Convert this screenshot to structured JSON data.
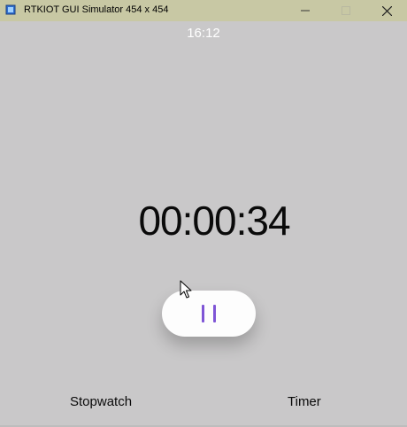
{
  "window": {
    "title": "RTKIOT GUI Simulator 454 x 454",
    "minimize_icon": "minimize-icon",
    "maximize_icon": "maximize-icon",
    "close_icon": "close-icon"
  },
  "status": {
    "clock": "16:12"
  },
  "stopwatch": {
    "elapsed": "00:00:34",
    "control_icon": "pause-icon",
    "accent_color": "#7f55d6"
  },
  "tabs": [
    {
      "label": "Stopwatch"
    },
    {
      "label": "Timer"
    }
  ],
  "colors": {
    "background": "#c9c8c9",
    "titlebar": "#c8c8a4",
    "button": "#fdfdfd"
  }
}
